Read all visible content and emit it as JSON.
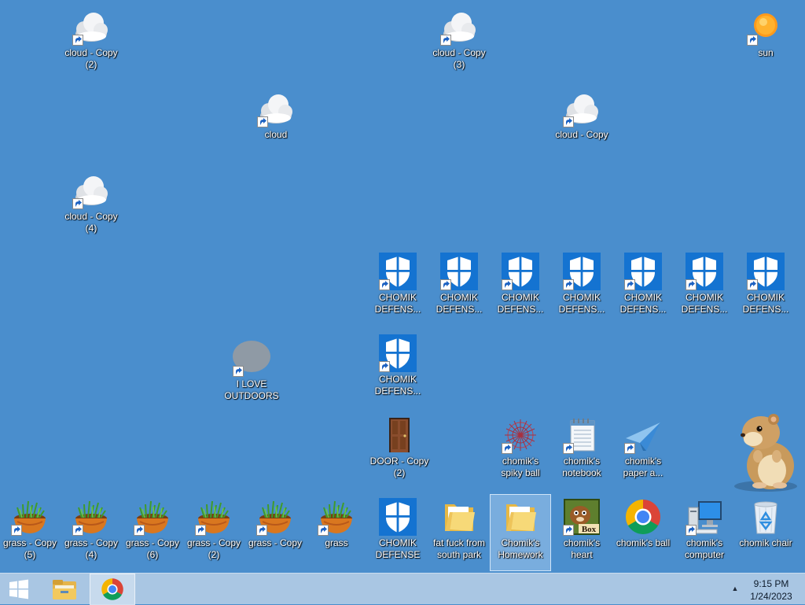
{
  "desktop": {
    "background_color": "#4a8ecd",
    "icons": [
      {
        "id": "cloud-copy-2",
        "label": "cloud - Copy\n(2)",
        "icon": "cloud-icon",
        "shortcut": true,
        "selected": false
      },
      {
        "id": "cloud-copy-3",
        "label": "cloud - Copy\n(3)",
        "icon": "cloud-icon",
        "shortcut": true,
        "selected": false
      },
      {
        "id": "sun",
        "label": "sun",
        "icon": "sun-icon",
        "shortcut": true,
        "selected": false
      },
      {
        "id": "cloud",
        "label": "cloud",
        "icon": "cloud-icon",
        "shortcut": true,
        "selected": false
      },
      {
        "id": "cloud-copy",
        "label": "cloud - Copy",
        "icon": "cloud-icon",
        "shortcut": true,
        "selected": false
      },
      {
        "id": "cloud-copy-4",
        "label": "cloud - Copy\n(4)",
        "icon": "cloud-icon",
        "shortcut": true,
        "selected": false
      },
      {
        "id": "chomik-defense-1",
        "label": "CHOMIK\nDEFENS...",
        "icon": "shield-icon",
        "shortcut": true,
        "selected": false
      },
      {
        "id": "chomik-defense-2",
        "label": "CHOMIK\nDEFENS...",
        "icon": "shield-icon",
        "shortcut": true,
        "selected": false
      },
      {
        "id": "chomik-defense-3",
        "label": "CHOMIK\nDEFENS...",
        "icon": "shield-icon",
        "shortcut": true,
        "selected": false
      },
      {
        "id": "chomik-defense-4",
        "label": "CHOMIK\nDEFENS...",
        "icon": "shield-icon",
        "shortcut": true,
        "selected": false
      },
      {
        "id": "chomik-defense-5",
        "label": "CHOMIK\nDEFENS...",
        "icon": "shield-icon",
        "shortcut": true,
        "selected": false
      },
      {
        "id": "chomik-defense-6",
        "label": "CHOMIK\nDEFENS...",
        "icon": "shield-icon",
        "shortcut": true,
        "selected": false
      },
      {
        "id": "chomik-defense-7",
        "label": "CHOMIK\nDEFENS...",
        "icon": "shield-icon",
        "shortcut": true,
        "selected": false
      },
      {
        "id": "chomik-defense-8",
        "label": "CHOMIK\nDEFENS...",
        "icon": "shield-icon",
        "shortcut": true,
        "selected": false
      },
      {
        "id": "i-love-outdoors",
        "label": "I LOVE\nOUTDOORS",
        "icon": "gray-blob-icon",
        "shortcut": true,
        "selected": false
      },
      {
        "id": "door-copy-2",
        "label": "DOOR - Copy\n(2)",
        "icon": "door-icon",
        "shortcut": false,
        "selected": false
      },
      {
        "id": "chomiks-spiky-ball",
        "label": "chomik's\nspiky ball",
        "icon": "spiky-ball-icon",
        "shortcut": true,
        "selected": false
      },
      {
        "id": "chomiks-notebook",
        "label": "chomik's\nnotebook",
        "icon": "notebook-icon",
        "shortcut": true,
        "selected": false
      },
      {
        "id": "chomiks-paper-a",
        "label": "chomik's\npaper a...",
        "icon": "paper-airplane-icon",
        "shortcut": true,
        "selected": false
      },
      {
        "id": "grass-copy-5",
        "label": "grass - Copy\n(5)",
        "icon": "grass-pot-icon",
        "shortcut": true,
        "selected": false
      },
      {
        "id": "grass-copy-4",
        "label": "grass - Copy\n(4)",
        "icon": "grass-pot-icon",
        "shortcut": true,
        "selected": false
      },
      {
        "id": "grass-copy-6",
        "label": "grass - Copy\n(6)",
        "icon": "grass-pot-icon",
        "shortcut": true,
        "selected": false
      },
      {
        "id": "grass-copy-2",
        "label": "grass - Copy\n(2)",
        "icon": "grass-pot-icon",
        "shortcut": true,
        "selected": false
      },
      {
        "id": "grass-copy",
        "label": "grass - Copy",
        "icon": "grass-pot-icon",
        "shortcut": true,
        "selected": false
      },
      {
        "id": "grass",
        "label": "grass",
        "icon": "grass-pot-icon",
        "shortcut": true,
        "selected": false
      },
      {
        "id": "chomik-defense",
        "label": "CHOMIK\nDEFENSE",
        "icon": "shield-icon",
        "shortcut": false,
        "selected": false
      },
      {
        "id": "fat-fuck-from-south-park",
        "label": "fat fuck from\nsouth park",
        "icon": "folder-icon",
        "shortcut": false,
        "selected": false
      },
      {
        "id": "chomiks-homework",
        "label": "Chomik's\nHomework",
        "icon": "folder-icon",
        "shortcut": false,
        "selected": true
      },
      {
        "id": "chomiks-heart",
        "label": "chomik's\nheart",
        "icon": "box-game-icon",
        "shortcut": true,
        "selected": false
      },
      {
        "id": "chomiks-ball",
        "label": "chomik's ball",
        "icon": "chrome-icon",
        "shortcut": false,
        "selected": false
      },
      {
        "id": "chomiks-computer",
        "label": "chomik's\ncomputer",
        "icon": "computer-icon",
        "shortcut": true,
        "selected": false
      },
      {
        "id": "chomik-chair",
        "label": "chomik chair",
        "icon": "recycle-bin-icon",
        "shortcut": false,
        "selected": false
      }
    ],
    "overlay": {
      "icon": "hamster-icon"
    }
  },
  "taskbar": {
    "start": {
      "icon": "windows-logo-icon"
    },
    "pinned": [
      {
        "id": "file-explorer",
        "icon": "folder-explorer-icon",
        "active": false
      },
      {
        "id": "chrome",
        "icon": "chrome-icon",
        "active": true
      }
    ],
    "tray": {
      "chevron": "▲",
      "time": "9:15 PM",
      "date": "1/24/2023"
    }
  }
}
